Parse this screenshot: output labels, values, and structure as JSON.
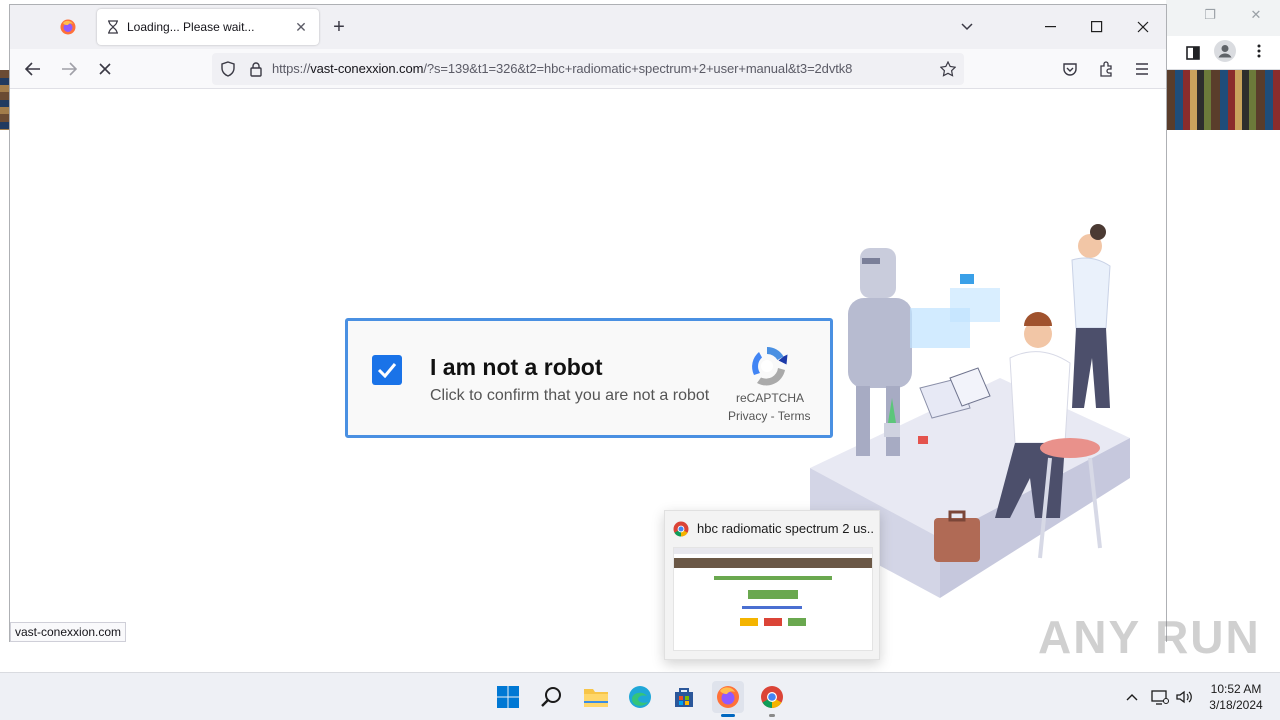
{
  "browser": {
    "tabs": [
      {
        "title": "Loading... Please wait...",
        "active": true
      }
    ],
    "url": {
      "prefix": "https://",
      "domain": "vast-conexxion.com",
      "rest": "/?s=139&t1=326&t2=hbc+radiomatic+spectrum+2+user+manual&t3=2dvtk8"
    },
    "status_text": "vast-conexxion.com"
  },
  "captcha": {
    "title": "I am not a robot",
    "subtitle": "Click to confirm that you are not a robot",
    "brand": "reCAPTCHA",
    "links": "Privacy - Terms",
    "checked": true
  },
  "preview": {
    "title": "hbc radiomatic spectrum 2 us..."
  },
  "watermark": "ANY RUN",
  "taskbar": {
    "apps": [
      "start-icon",
      "search-icon",
      "file-explorer-icon",
      "edge-icon",
      "store-icon",
      "firefox-icon",
      "chrome-icon"
    ],
    "time": "10:52 AM",
    "date": "3/18/2024"
  },
  "colors": {
    "accent": "#1a73e8",
    "captcha_border": "#4a90e2",
    "firefox_tabbar": "#f0f0f4"
  }
}
